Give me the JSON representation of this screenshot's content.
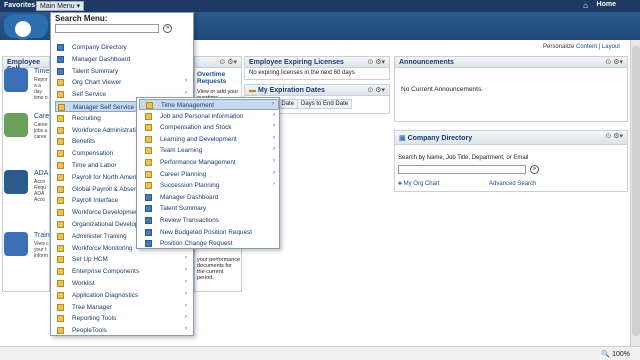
{
  "topbar": {
    "favorites": "Favorites",
    "main_menu": "Main Menu",
    "home": "Home"
  },
  "personalize": {
    "prefix": "Personalize",
    "content": "Content",
    "sep": "|",
    "layout": "Layout"
  },
  "employee_self": {
    "header": "Employee Self",
    "items": [
      {
        "title": "Time",
        "desc": "Repor a a day time p",
        "color": "#3a6fb5"
      },
      {
        "title": "Care",
        "desc": "Caree jobs a caree",
        "color": "#6aa05a"
      },
      {
        "title": "ADA",
        "desc": "Acco Requ ADA Acco Requ",
        "color": "#2d5a8c"
      },
      {
        "title": "Train Sum",
        "desc": "View c your t inform",
        "color": "#3a6fb5"
      }
    ]
  },
  "team_pagelet": {
    "ctl": "⊙ ⚙▾",
    "overtime_title": "Overtime Requests",
    "overtime_desc": "View or add your overtime",
    "footer_desc": "your performance documents for the current period."
  },
  "licenses": {
    "header": "Employee Expiring Licenses",
    "ctl": "⊙ ⚙▾",
    "body": "No expiring licenses in the next 60 days"
  },
  "expiration": {
    "header": "My Expiration Dates",
    "ctl": "⊙ ⚙▾",
    "columns": [
      "ition",
      "End Date",
      "Days to End Date"
    ]
  },
  "announcements": {
    "header": "Announcements",
    "ctl": "⊙ ⚙▾",
    "body": "No Current Announcements."
  },
  "company_directory": {
    "header": "Company Directory",
    "ctl": "⊙ ⚙▾",
    "search_label": "Search by Name, Job Title, Department, or Email",
    "org_chart": "My Org Chart",
    "advanced": "Advanced Search"
  },
  "main_menu": {
    "title": "Search Menu:",
    "go": "»",
    "items": [
      {
        "label": "Company Directory",
        "type": "doc",
        "arrow": false
      },
      {
        "label": "Manager Dashboard",
        "type": "doc",
        "arrow": false
      },
      {
        "label": "Talent Summary",
        "type": "doc",
        "arrow": false
      },
      {
        "label": "Org Chart Viewer",
        "type": "fold",
        "arrow": true
      },
      {
        "label": "Self Service",
        "type": "fold",
        "arrow": true
      },
      {
        "label": "Manager Self Service",
        "type": "fold",
        "arrow": true,
        "highlight": true
      },
      {
        "label": "Recruiting",
        "type": "fold",
        "arrow": true
      },
      {
        "label": "Workforce Administration",
        "type": "fold",
        "arrow": true
      },
      {
        "label": "Benefits",
        "type": "fold",
        "arrow": true
      },
      {
        "label": "Compensation",
        "type": "fold",
        "arrow": true
      },
      {
        "label": "Time and Labor",
        "type": "fold",
        "arrow": true
      },
      {
        "label": "Payroll for North America",
        "type": "fold",
        "arrow": true
      },
      {
        "label": "Global Payroll & Absence",
        "type": "fold",
        "arrow": true
      },
      {
        "label": "Payroll Interface",
        "type": "fold",
        "arrow": true
      },
      {
        "label": "Workforce Development",
        "type": "fold",
        "arrow": true
      },
      {
        "label": "Organizational Development",
        "type": "fold",
        "arrow": true
      },
      {
        "label": "Administer Training",
        "type": "fold",
        "arrow": true
      },
      {
        "label": "Workforce Monitoring",
        "type": "fold",
        "arrow": true
      },
      {
        "label": "Set Up HCM",
        "type": "fold",
        "arrow": true
      },
      {
        "label": "Enterprise Components",
        "type": "fold",
        "arrow": true
      },
      {
        "label": "Worklist",
        "type": "fold",
        "arrow": true
      },
      {
        "label": "Application Diagnostics",
        "type": "fold",
        "arrow": true
      },
      {
        "label": "Tree Manager",
        "type": "fold",
        "arrow": true
      },
      {
        "label": "Reporting Tools",
        "type": "fold",
        "arrow": true
      },
      {
        "label": "PeopleTools",
        "type": "fold",
        "arrow": true
      }
    ]
  },
  "submenu": {
    "items": [
      {
        "label": "Time Management",
        "type": "fold",
        "arrow": true,
        "highlight": true
      },
      {
        "label": "Job and Personal Information",
        "type": "fold",
        "arrow": true
      },
      {
        "label": "Compensation and Stock",
        "type": "fold",
        "arrow": true
      },
      {
        "label": "Learning and Development",
        "type": "fold",
        "arrow": true
      },
      {
        "label": "Team Learning",
        "type": "fold",
        "arrow": true
      },
      {
        "label": "Performance Management",
        "type": "fold",
        "arrow": true
      },
      {
        "label": "Career Planning",
        "type": "fold",
        "arrow": true
      },
      {
        "label": "Succession Planning",
        "type": "fold",
        "arrow": true
      },
      {
        "label": "Manager Dashboard",
        "type": "doc",
        "arrow": false
      },
      {
        "label": "Talent Summary",
        "type": "doc",
        "arrow": false
      },
      {
        "label": "Review Transactions",
        "type": "doc",
        "arrow": false
      },
      {
        "label": "New Budgeted Position Request",
        "type": "doc",
        "arrow": false
      },
      {
        "label": "Position Change Request",
        "type": "doc",
        "arrow": false
      }
    ]
  },
  "statusbar": {
    "zoom": "🔍 100%"
  }
}
